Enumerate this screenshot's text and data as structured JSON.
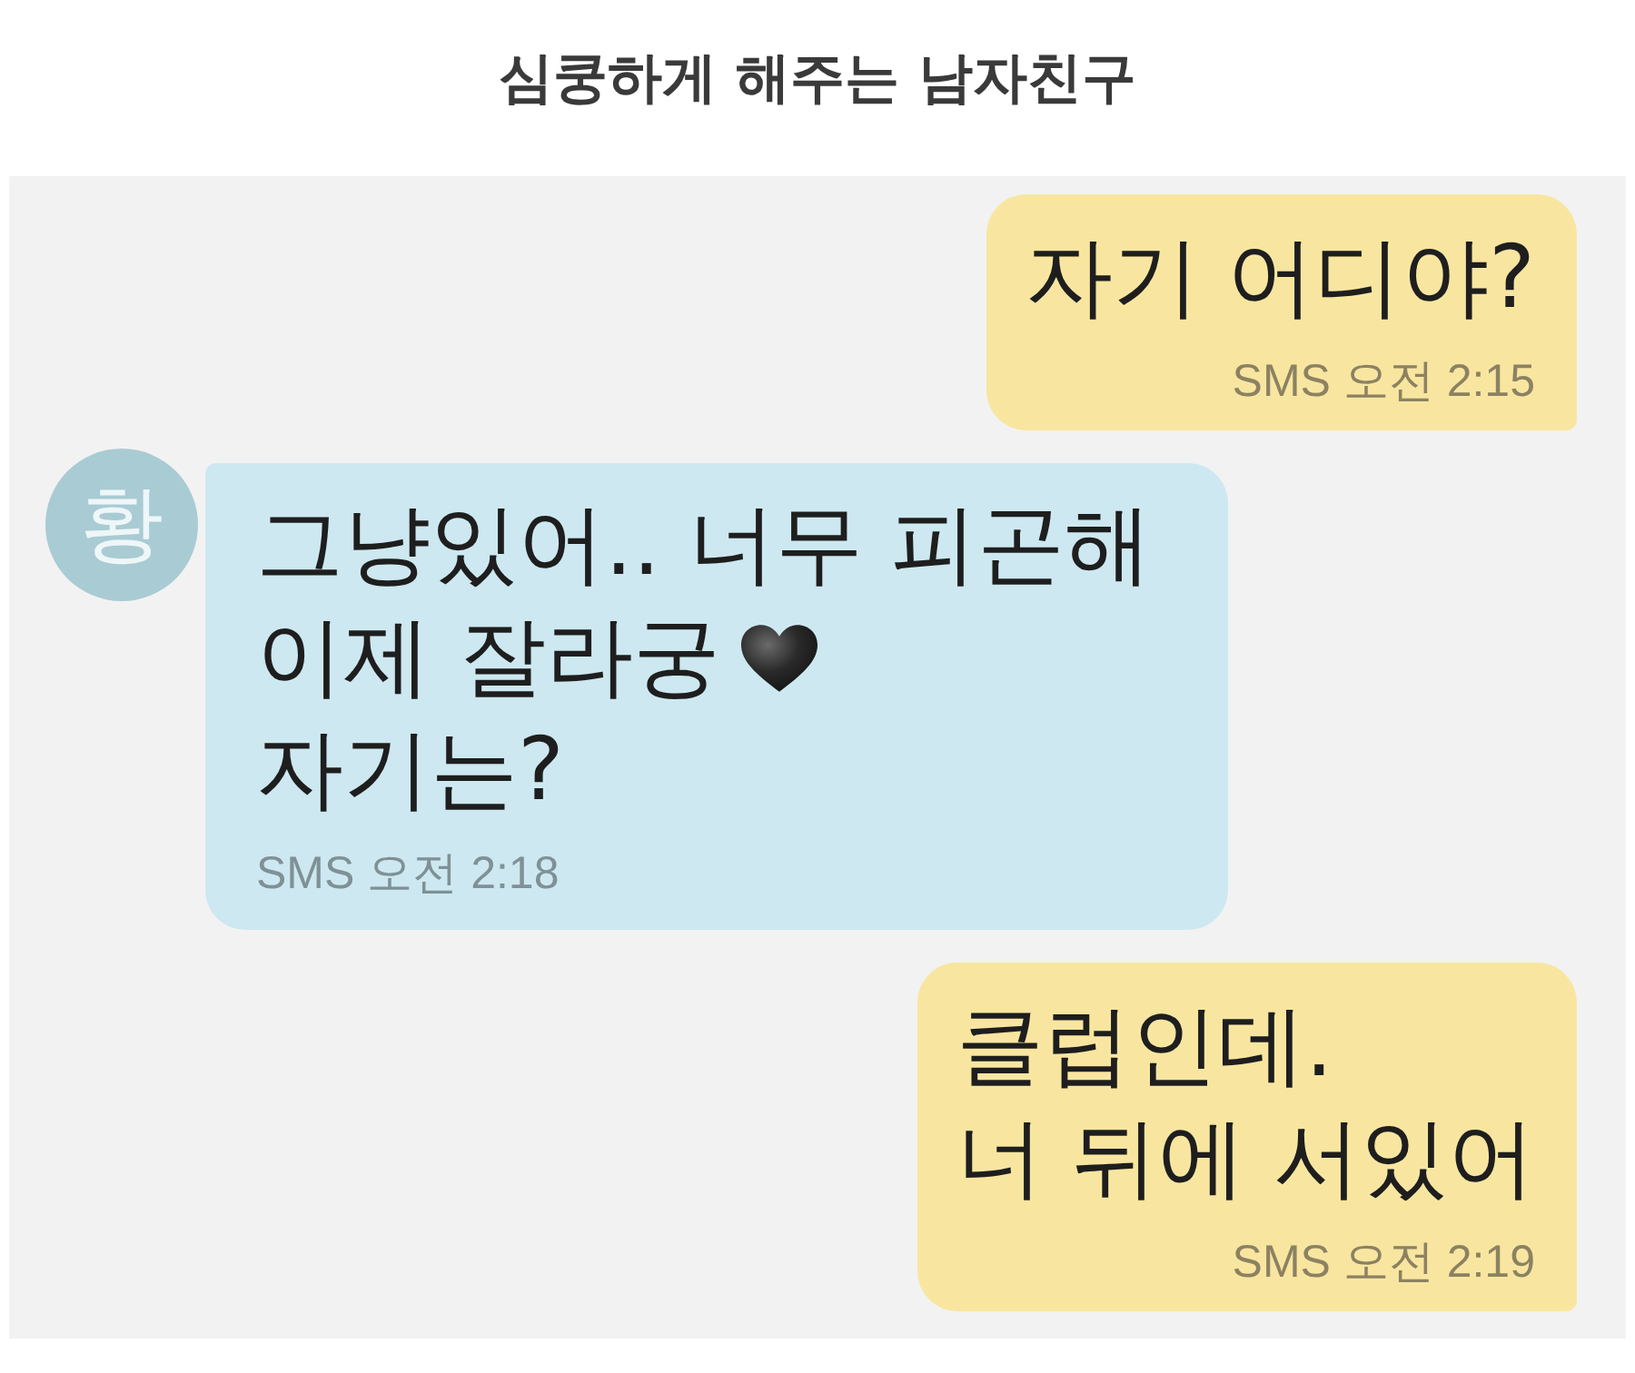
{
  "title": "심쿵하게 해주는 남자친구",
  "messages": [
    {
      "kind": "sent",
      "lines": [
        {
          "text": "자기 어디야?",
          "heart": false
        }
      ],
      "meta": "SMS 오전 2:15"
    },
    {
      "kind": "received",
      "avatar": "황",
      "lines": [
        {
          "text": "그냥있어.. 너무 피곤해",
          "heart": false
        },
        {
          "text": "이제 잘라궁",
          "heart": true
        },
        {
          "text": "자기는?",
          "heart": false
        }
      ],
      "meta": "SMS 오전 2:18"
    },
    {
      "kind": "sent",
      "lines": [
        {
          "text": "클럽인데.",
          "heart": false
        },
        {
          "text": "너 뒤에 서있어",
          "heart": false
        }
      ],
      "meta": "SMS 오전 2:19"
    }
  ]
}
